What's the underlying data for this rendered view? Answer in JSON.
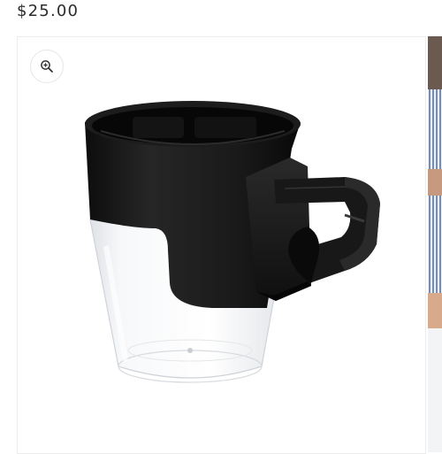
{
  "product": {
    "price": "$25.00"
  },
  "gallery": {
    "zoom_icon": "zoom-in-icon",
    "main_image": "cup-holder-product-photo",
    "next_image": "lifestyle-photo-thumbnail"
  },
  "colors": {
    "price_text": "#2b2b2b",
    "product_black": "#1b1b1b",
    "clear_cup": "#eef0f3"
  }
}
